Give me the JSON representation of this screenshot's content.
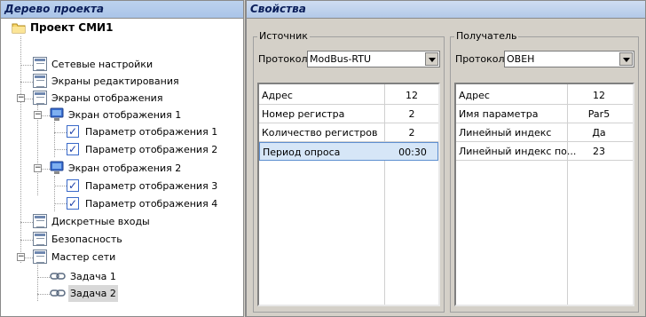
{
  "left_panel": {
    "title": "Дерево проекта",
    "root": "Проект СМИ1",
    "items": [
      "Сетевые настройки",
      "Экраны редактирования",
      "Экраны отображения",
      "Экран отображения 1",
      "Параметр отображения 1",
      "Параметр отображения 2",
      "Экран отображения 2",
      "Параметр отображения 3",
      "Параметр отображения 4",
      "Дискретные входы",
      "Безопасность",
      "Мастер сети",
      "Задача 1",
      "Задача 2"
    ],
    "expander_symbol": "−"
  },
  "right_panel": {
    "title": "Свойства",
    "source": {
      "title": "Источник",
      "protocol_label": "Протокол:",
      "protocol_value": "ModBus-RTU",
      "rows": [
        {
          "name": "Адрес",
          "value": "12"
        },
        {
          "name": "Номер регистра",
          "value": "2"
        },
        {
          "name": "Количество регистров",
          "value": "2"
        },
        {
          "name": "Период опроса",
          "value": "00:30"
        }
      ]
    },
    "receiver": {
      "title": "Получатель",
      "protocol_label": "Протокол:",
      "protocol_value": "ОВЕН",
      "rows": [
        {
          "name": "Адрес",
          "value": "12"
        },
        {
          "name": "Имя параметра",
          "value": "Par5"
        },
        {
          "name": "Линейный индекс",
          "value": "Да"
        },
        {
          "name": "Линейный индекс по...",
          "value": "23"
        }
      ]
    }
  },
  "colors": {
    "header_text": "#0a1e5a",
    "selected_row": "#d6e6f7",
    "selected_tree_item": "#d8d8d8",
    "panel_bg": "#d4d0c8"
  }
}
